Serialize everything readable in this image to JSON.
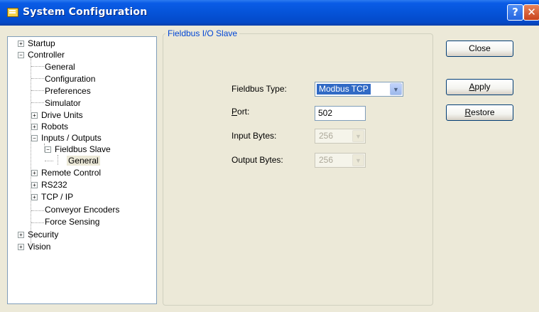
{
  "window": {
    "title": "System Configuration",
    "help_glyph": "?",
    "close_glyph": "✕"
  },
  "tree": {
    "expand_glyph": "+",
    "collapse_glyph": "−",
    "items": {
      "startup": "Startup",
      "controller": "Controller",
      "general": "General",
      "configuration": "Configuration",
      "preferences": "Preferences",
      "simulator": "Simulator",
      "drive_units": "Drive Units",
      "robots": "Robots",
      "inputs_outputs": "Inputs / Outputs",
      "fieldbus_slave": "Fieldbus Slave",
      "fieldbus_general": "General",
      "remote_control": "Remote Control",
      "rs232": "RS232",
      "tcp_ip": "TCP / IP",
      "conveyor_encoders": "Conveyor Encoders",
      "force_sensing": "Force Sensing",
      "security": "Security",
      "vision": "Vision"
    }
  },
  "panel": {
    "group_title": "Fieldbus I/O Slave",
    "fieldbus_type_label": "Fieldbus Type:",
    "fieldbus_type_value": "Modbus TCP",
    "port_label_u": "P",
    "port_label_rest": "ort:",
    "port_value": "502",
    "input_bytes_label": "Input Bytes:",
    "input_bytes_value": "256",
    "output_bytes_label": "Output Bytes:",
    "output_bytes_value": "256",
    "dropdown_glyph": "▼"
  },
  "buttons": {
    "close": "Close",
    "apply_u": "A",
    "apply_rest": "pply",
    "restore_u": "R",
    "restore_rest": "estore"
  },
  "colors": {
    "titlebar": "#0553d8",
    "selection": "#316ac5",
    "group_title": "#0046d5"
  }
}
